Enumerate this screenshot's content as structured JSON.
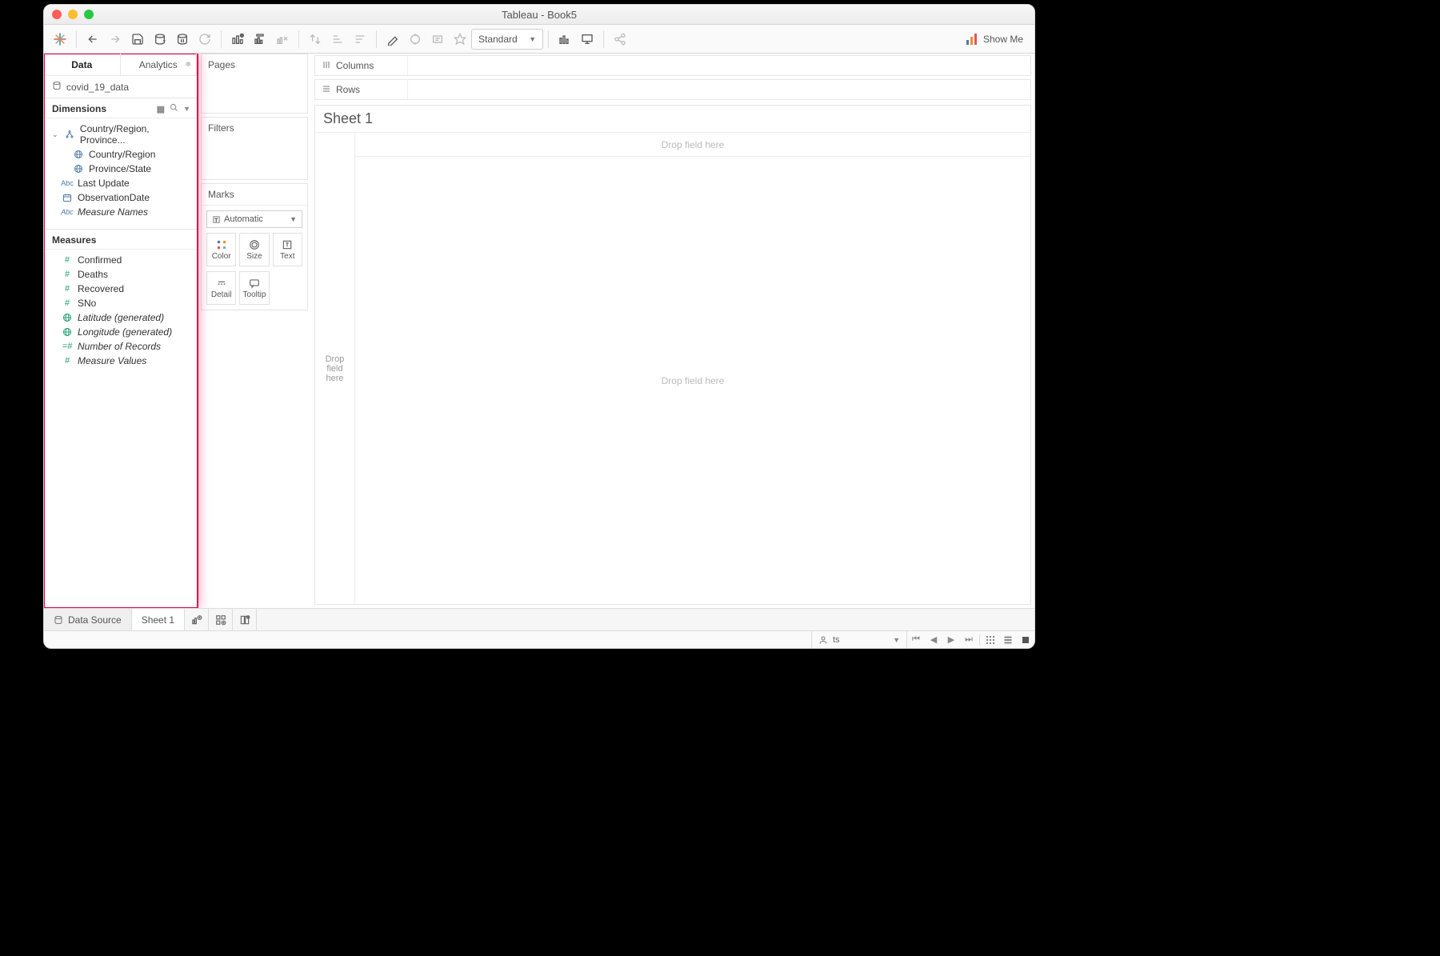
{
  "window": {
    "title": "Tableau - Book5"
  },
  "toolbar": {
    "fit_mode": "Standard",
    "show_me": "Show Me"
  },
  "sidebar": {
    "tabs": {
      "data": "Data",
      "analytics": "Analytics"
    },
    "datasource": "covid_19_data",
    "dimensions_label": "Dimensions",
    "dimensions": {
      "hierarchy": "Country/Region, Province...",
      "country": "Country/Region",
      "province": "Province/State",
      "last_update": "Last Update",
      "observation_date": "ObservationDate",
      "measure_names": "Measure Names"
    },
    "measures_label": "Measures",
    "measures": {
      "confirmed": "Confirmed",
      "deaths": "Deaths",
      "recovered": "Recovered",
      "sno": "SNo",
      "latitude": "Latitude (generated)",
      "longitude": "Longitude (generated)",
      "num_records": "Number of Records",
      "measure_values": "Measure Values"
    }
  },
  "shelves": {
    "pages": "Pages",
    "filters": "Filters",
    "marks": "Marks",
    "mark_type": "Automatic",
    "color": "Color",
    "size": "Size",
    "text": "Text",
    "detail": "Detail",
    "tooltip": "Tooltip",
    "columns": "Columns",
    "rows": "Rows"
  },
  "worksheet": {
    "title": "Sheet 1",
    "drop_field_here": "Drop field here",
    "drop_field_left": "Drop\nfield\nhere"
  },
  "tabs": {
    "data_source": "Data Source",
    "sheet1": "Sheet 1"
  },
  "status": {
    "user": "ts"
  }
}
